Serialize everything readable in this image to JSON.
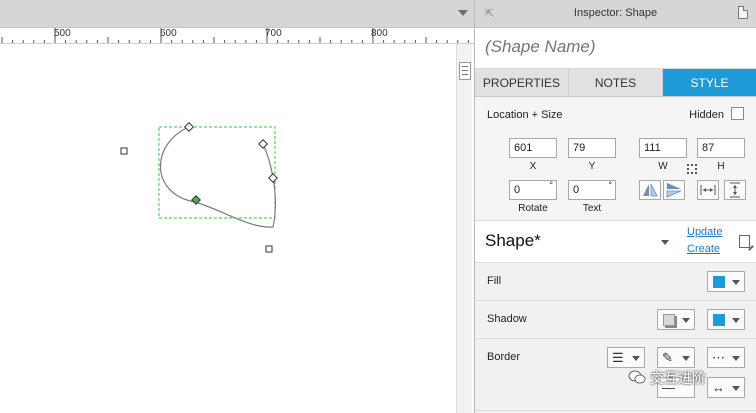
{
  "ruler": {
    "ticks": [
      "500",
      "600",
      "700",
      "800"
    ]
  },
  "inspector": {
    "title": "Inspector: Shape",
    "shape_name_placeholder": "(Shape Name)",
    "tabs": [
      {
        "label": "PROPERTIES",
        "active": false
      },
      {
        "label": "NOTES",
        "active": false
      },
      {
        "label": "STYLE",
        "active": true
      }
    ],
    "location_size": {
      "title": "Location + Size",
      "hidden_label": "Hidden",
      "hidden_checked": false,
      "x": {
        "value": "601",
        "caption": "X"
      },
      "y": {
        "value": "79",
        "caption": "Y"
      },
      "w": {
        "value": "111",
        "caption": "W"
      },
      "h": {
        "value": "87",
        "caption": "H"
      },
      "rotate": {
        "value": "0",
        "caption": "Rotate",
        "unit": "°"
      },
      "text_rotate": {
        "value": "0",
        "caption": "Text",
        "unit": "°"
      }
    },
    "style": {
      "shape_style": "Shape*",
      "update_link": "Update",
      "create_link": "Create"
    },
    "properties": {
      "fill_label": "Fill",
      "shadow_label": "Shadow",
      "border_label": "Border"
    },
    "colors": {
      "accent": "#1e9ad6",
      "fill_swatch": "#1e9ad6",
      "shadow_swatch": "#1e9ad6",
      "selection": "#2ecc2e"
    }
  },
  "watermark": "交互进阶"
}
